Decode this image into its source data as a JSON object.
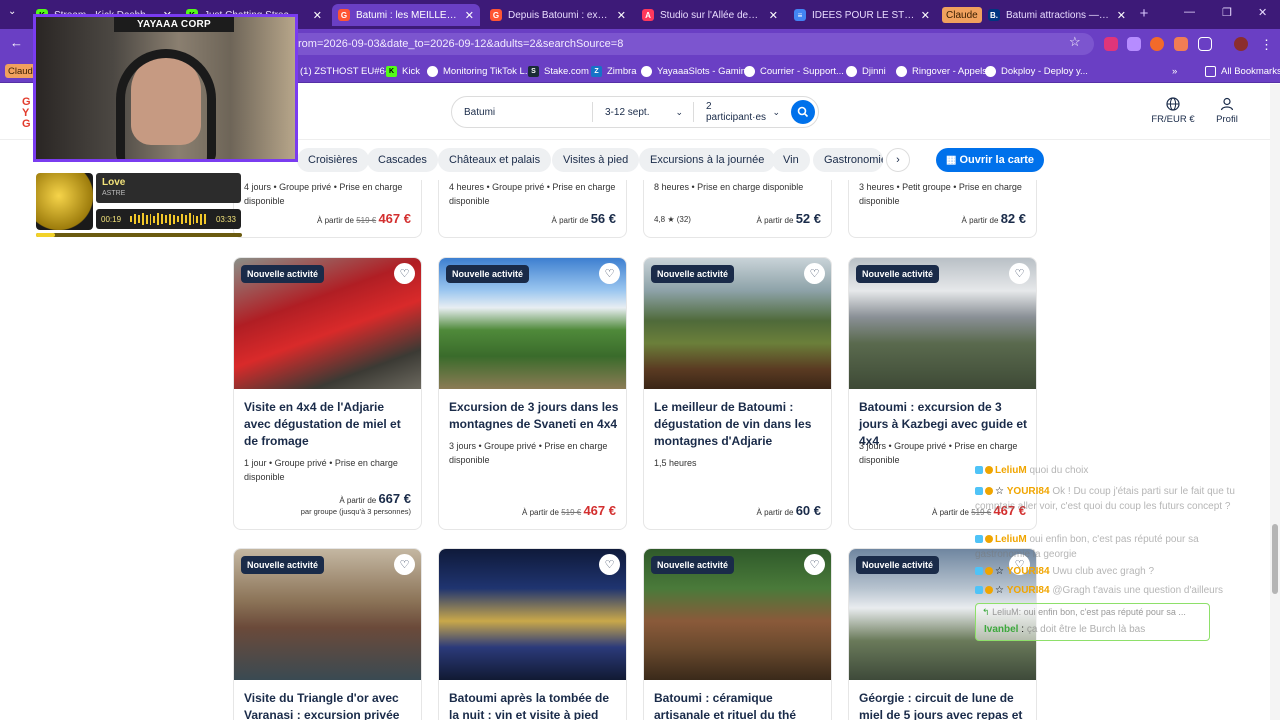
{
  "tabs": [
    {
      "label": "Stream - Kick Dashboard",
      "icon": "kick-icon"
    },
    {
      "label": "Just Chatting Streaming - Live",
      "icon": "kick-icon"
    },
    {
      "label": "Batumi : les MEILLEURES activ",
      "icon": "getyourguide-icon"
    },
    {
      "label": "Depuis Batoumi : excursion à",
      "icon": "getyourguide-icon"
    },
    {
      "label": "Studio sur l'Allée des Héros -",
      "icon": "airbnb-icon"
    },
    {
      "label": "IDEES POUR LE STREAM YAYA",
      "icon": "docs-icon"
    },
    {
      "label": "Claude",
      "icon": "claude-icon"
    },
    {
      "label": "Batumi attractions — Booking",
      "icon": "booking-icon"
    }
  ],
  "url": "rom=2026-09-03&date_to=2026-09-12&adults=2&searchSource=8",
  "profile_chip": "Claude",
  "bookmarks": [
    "(1) ZSTHOST EU#6-...",
    "Kick",
    "Monitoring TikTok L...",
    "Stake.com",
    "Zimbra",
    "YayaaaSlots - Gamin...",
    "Courrier - Support...",
    "Djinni",
    "Ringover - Appels",
    "Dokploy - Deploy y..."
  ],
  "all_bookmarks": "All Bookmarks",
  "search": {
    "location": "Batumi",
    "dates": "3-12 sept.",
    "participants": "2 participant·es"
  },
  "header": {
    "currency": "FR/EUR €",
    "profile": "Profil"
  },
  "chips": [
    "Croisières",
    "Cascades",
    "Châteaux et palais",
    "Visites à pied",
    "Excursions à la journée",
    "Vin",
    "Gastronomie"
  ],
  "map_button": "Ouvrir la carte",
  "partial_cards": [
    {
      "meta": "4 jours • Groupe privé • Prise en charge disponible",
      "price_prefix": "À partir de",
      "old": "519 €",
      "price": "467 €",
      "rating": ""
    },
    {
      "meta": "4 heures • Groupe privé • Prise en charge disponible",
      "price_prefix": "À partir de",
      "old": "",
      "price": "56 €",
      "rating": ""
    },
    {
      "meta": "8 heures • Prise en charge disponible",
      "price_prefix": "À partir de",
      "old": "",
      "price": "52 €",
      "rating": "4,8 ★ (32)"
    },
    {
      "meta": "3 heures • Petit groupe • Prise en charge disponible",
      "price_prefix": "À partir de",
      "old": "",
      "price": "82 €",
      "rating": ""
    }
  ],
  "badge": "Nouvelle activité",
  "row1": [
    {
      "title": "Visite en 4x4 de l'Adjarie avec dégustation de miel et de fromage",
      "meta": "1 jour • Groupe privé • Prise en charge disponible",
      "price_prefix": "À partir de",
      "old": "",
      "price": "667 €",
      "sub": "par groupe (jusqu'à 3 personnes)"
    },
    {
      "title": "Excursion de 3 jours dans les montagnes de Svaneti en 4x4",
      "meta": "3 jours • Groupe privé • Prise en charge disponible",
      "price_prefix": "À partir de",
      "old": "519 €",
      "price": "467 €",
      "sub": ""
    },
    {
      "title": "Le meilleur de Batoumi : dégustation de vin dans les montagnes d'Adjarie",
      "meta": "1,5 heures",
      "price_prefix": "À partir de",
      "old": "",
      "price": "60 €",
      "sub": ""
    },
    {
      "title": "Batoumi : excursion de 3 jours à Kazbegi avec guide et 4x4",
      "meta": "3 jours • Groupe privé • Prise en charge disponible",
      "price_prefix": "À partir de",
      "old": "519 €",
      "price": "467 €",
      "sub": ""
    }
  ],
  "row2": [
    {
      "title": "Visite du Triangle d'or avec Varanasi : excursion privée de"
    },
    {
      "title": "Batoumi après la tombée de la nuit : vin et visite à pied"
    },
    {
      "title": "Batoumi : céramique artisanale et rituel du thé géorgien"
    },
    {
      "title": "Géorgie : circuit de lune de miel de 5 jours avec repas et"
    }
  ],
  "webcam": {
    "label": "YAYAAA CORP"
  },
  "music": {
    "song": "Love",
    "artist": "ASTRE",
    "elapsed": "00:19",
    "total": "03:33",
    "progress": 0.09
  },
  "chat": [
    {
      "nick": "LeliuM",
      "color": "#f0a500",
      "msg": "quoi du choix"
    },
    {
      "nick": "YOURI84",
      "color": "#f0a500",
      "msg": "Ok ! Du coup j'étais parti sur le fait que tu comptais aller voir, c'est quoi du coup les futurs concept ?"
    },
    {
      "nick": "LeliuM",
      "color": "#f0a500",
      "msg": "oui enfin bon, c'est pas réputé pour sa gastronomie la georgie"
    },
    {
      "nick": "YOURI84",
      "color": "#f0a500",
      "msg": "Uwu club avec gragh ?"
    },
    {
      "nick": "YOURI84",
      "color": "#f0a500",
      "msg": "@Gragh t'avais une question d'ailleurs"
    }
  ],
  "chat_reply": {
    "quoted": "LeliuM: oui enfin bon, c'est pas réputé pour sa ...",
    "nick": "Ivanbel",
    "msg": "ça doit être le Burch là bas"
  }
}
